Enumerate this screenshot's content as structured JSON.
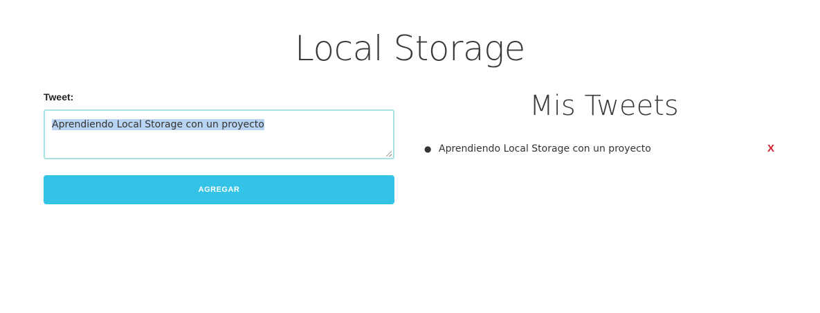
{
  "header": {
    "title": "Local Storage"
  },
  "form": {
    "label": "Tweet:",
    "textarea_value": "Aprendiendo Local Storage con un proyecto",
    "submit_label": "AGREGAR"
  },
  "tweets": {
    "title": "Mis Tweets",
    "items": [
      {
        "text": "Aprendiendo Local Storage con un proyecto",
        "delete_label": "X"
      }
    ]
  },
  "colors": {
    "button_bg": "#33c3e6",
    "textarea_border": "#a8e3e3",
    "selection_highlight": "#b9d3f2",
    "delete_color": "#d81b30"
  }
}
